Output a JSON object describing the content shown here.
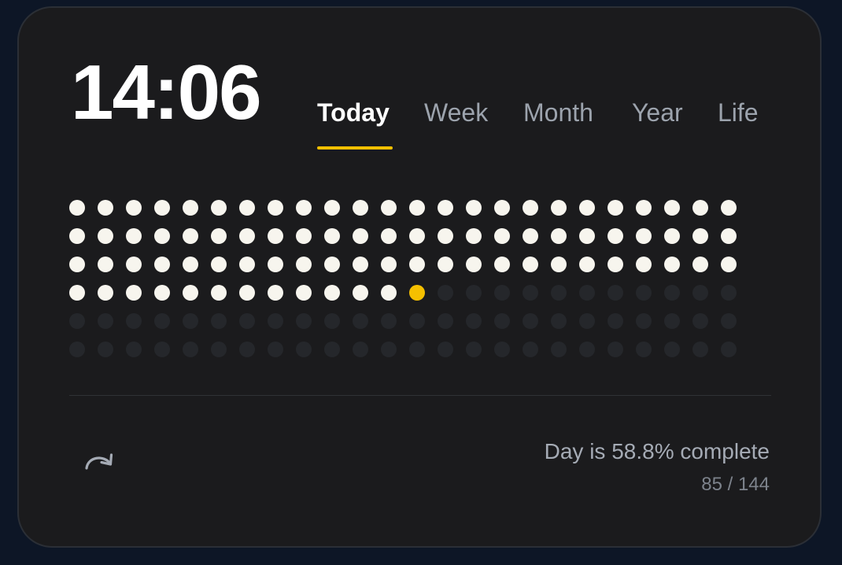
{
  "clock": {
    "time": "14:06"
  },
  "tabs": [
    {
      "label": "Today",
      "active": true
    },
    {
      "label": "Week",
      "active": false
    },
    {
      "label": "Month",
      "active": false
    },
    {
      "label": "Year",
      "active": false
    },
    {
      "label": "Life",
      "active": false
    }
  ],
  "progress": {
    "filled": 85,
    "total": 144,
    "columns": 24,
    "rows": 6,
    "filled_color": "#f7f5ee",
    "current_color": "#f5c000",
    "empty_color": "#25272b"
  },
  "footer": {
    "refresh_icon": "refresh-icon",
    "status_text": "Day is 58.8% complete",
    "count_text": "85 / 144"
  },
  "colors": {
    "accent": "#f5c000",
    "background": "#0d1626",
    "card": "#1b1b1d"
  }
}
